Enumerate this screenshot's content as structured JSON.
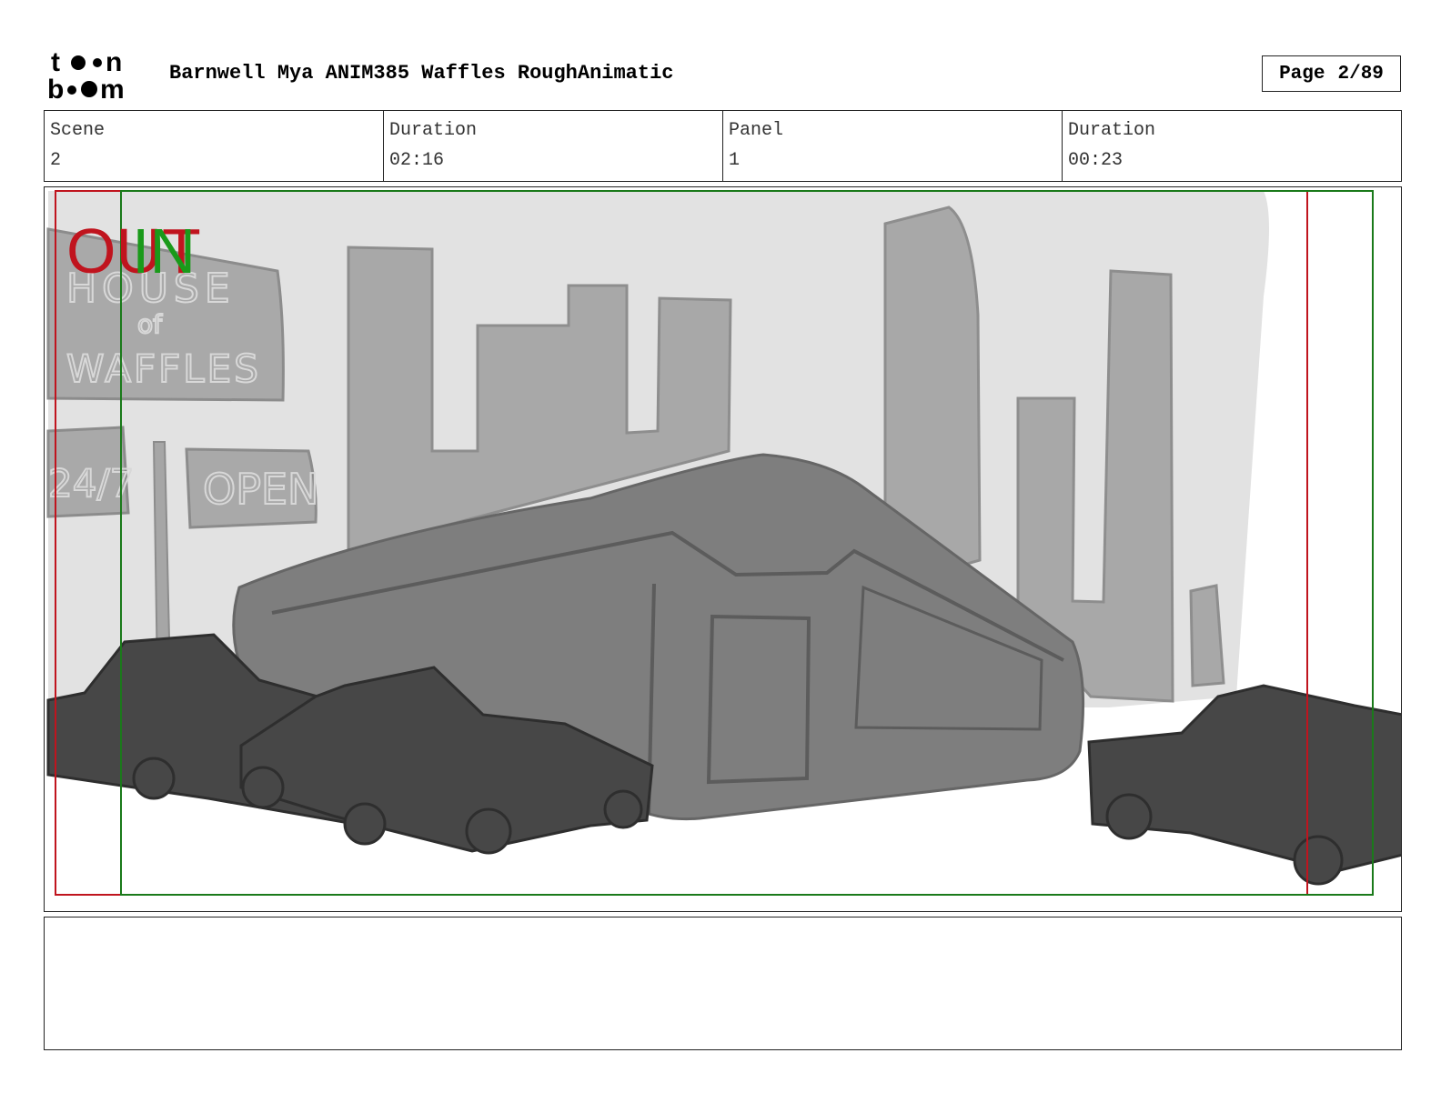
{
  "header": {
    "logo_text": "toonboom",
    "title": "Barnwell Mya ANIM385 Waffles RoughAnimatic",
    "page_label": "Page",
    "page_value": "2/89"
  },
  "info": [
    {
      "label": "Scene",
      "value": "2"
    },
    {
      "label": "Duration",
      "value": "02:16"
    },
    {
      "label": "Panel",
      "value": "1"
    },
    {
      "label": "Duration",
      "value": "00:23"
    }
  ],
  "panel": {
    "transition_out": "OUT",
    "transition_in": "IN",
    "sign_lines": [
      "HOUSE",
      "of",
      "WAFFLES"
    ],
    "sign_hours": "24/7",
    "sign_open": "OPEN"
  },
  "colors": {
    "frame_red": "#c0141e",
    "frame_green": "#1a7a1a",
    "sky": "#e2e2e2",
    "buildings": "#a8a8a8",
    "bus": "#7e7e7e",
    "cars": "#474747"
  },
  "notes": ""
}
